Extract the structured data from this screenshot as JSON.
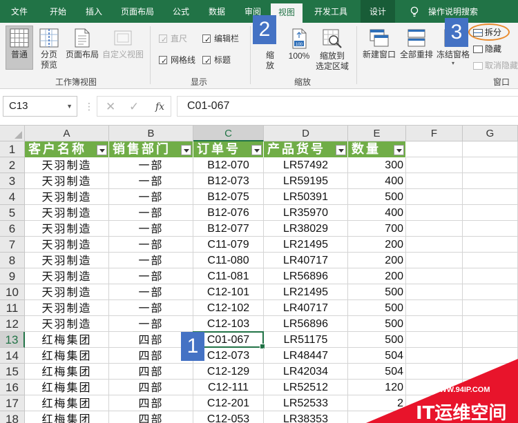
{
  "ribbon": {
    "tabs": [
      "文件",
      "开始",
      "插入",
      "页面布局",
      "公式",
      "数据",
      "审阅",
      "视图",
      "开发工具",
      "设计"
    ],
    "active_tab": "视图",
    "help_text": "操作说明搜索",
    "workbook_views": {
      "normal": "普通",
      "page_break_1": "分页",
      "page_break_2": "预览",
      "page_layout": "页面布局",
      "custom_views": "自定义视图",
      "group_label": "工作簿视图"
    },
    "show": {
      "ruler": "直尺",
      "formula_bar": "编辑栏",
      "gridlines": "网格线",
      "headings": "标题",
      "group_label": "显示"
    },
    "zoom": {
      "zoom_1": "缩",
      "zoom_2": "放",
      "hundred": "100%",
      "to_selection_1": "缩放到",
      "to_selection_2": "选定区域",
      "group_label": "缩放",
      "page_icon_text": "100"
    },
    "window": {
      "new_window": "新建窗口",
      "arrange_all": "全部重排",
      "freeze_panes": "冻结窗格",
      "split": "拆分",
      "hide": "隐藏",
      "unhide": "取消隐藏",
      "group_label": "窗口"
    }
  },
  "callouts": [
    "1",
    "2",
    "3"
  ],
  "formula_bar": {
    "name_box": "C13",
    "cancel_glyph": "✕",
    "enter_glyph": "✓",
    "fx_label": "fx",
    "value": "C01-067"
  },
  "sheet": {
    "column_letters": [
      "A",
      "B",
      "C",
      "D",
      "E",
      "F",
      "G"
    ],
    "selected_column": "C",
    "selected_row": "13",
    "header_row": [
      "客户名称",
      "销售部门",
      "订单号",
      "产品货号",
      "数量"
    ],
    "rows": [
      {
        "n": "2",
        "cells": [
          "天羽制造",
          "一部",
          "B12-070",
          "LR57492",
          "300"
        ]
      },
      {
        "n": "3",
        "cells": [
          "天羽制造",
          "一部",
          "B12-073",
          "LR59195",
          "400"
        ]
      },
      {
        "n": "4",
        "cells": [
          "天羽制造",
          "一部",
          "B12-075",
          "LR50391",
          "500"
        ]
      },
      {
        "n": "5",
        "cells": [
          "天羽制造",
          "一部",
          "B12-076",
          "LR35970",
          "400"
        ]
      },
      {
        "n": "6",
        "cells": [
          "天羽制造",
          "一部",
          "B12-077",
          "LR38029",
          "700"
        ]
      },
      {
        "n": "7",
        "cells": [
          "天羽制造",
          "一部",
          "C11-079",
          "LR21495",
          "200"
        ]
      },
      {
        "n": "8",
        "cells": [
          "天羽制造",
          "一部",
          "C11-080",
          "LR40717",
          "200"
        ]
      },
      {
        "n": "9",
        "cells": [
          "天羽制造",
          "一部",
          "C11-081",
          "LR56896",
          "200"
        ]
      },
      {
        "n": "10",
        "cells": [
          "天羽制造",
          "一部",
          "C12-101",
          "LR21495",
          "500"
        ]
      },
      {
        "n": "11",
        "cells": [
          "天羽制造",
          "一部",
          "C12-102",
          "LR40717",
          "500"
        ]
      },
      {
        "n": "12",
        "cells": [
          "天羽制造",
          "一部",
          "C12-103",
          "LR56896",
          "500"
        ]
      },
      {
        "n": "13",
        "cells": [
          "红梅集团",
          "四部",
          "C01-067",
          "LR51175",
          "500"
        ]
      },
      {
        "n": "14",
        "cells": [
          "红梅集团",
          "四部",
          "C12-073",
          "LR48447",
          "504"
        ]
      },
      {
        "n": "15",
        "cells": [
          "红梅集团",
          "四部",
          "C12-129",
          "LR42034",
          "504"
        ]
      },
      {
        "n": "16",
        "cells": [
          "红梅集团",
          "四部",
          "C12-111",
          "LR52512",
          "120"
        ]
      },
      {
        "n": "17",
        "cells": [
          "红梅集团",
          "四部",
          "C12-201",
          "LR52533",
          "2"
        ]
      },
      {
        "n": "18",
        "cells": [
          "红梅集团",
          "四部",
          "C12-053",
          "LR38353",
          ""
        ]
      }
    ]
  },
  "watermark": {
    "url": "WWW.94IP.COM",
    "title": "IT运维空间"
  },
  "colors": {
    "ribbon_green": "#217346",
    "table_header_green": "#70ad47",
    "callout_blue": "#4472c4",
    "split_highlight": "#e98a2c",
    "watermark_red": "#e8142b"
  }
}
